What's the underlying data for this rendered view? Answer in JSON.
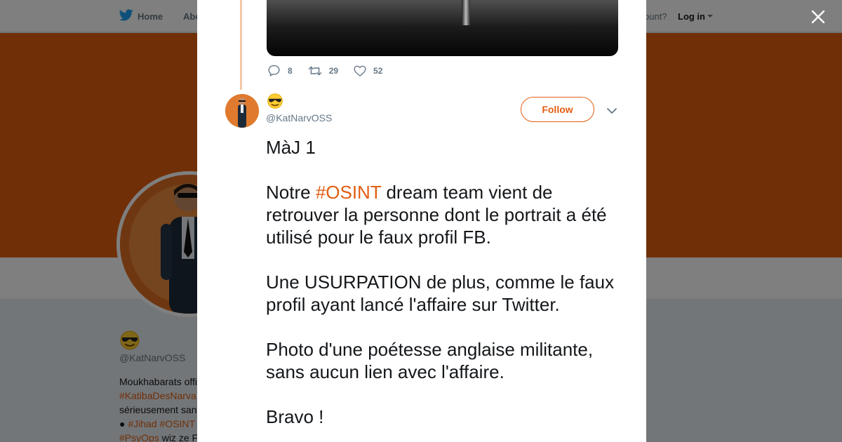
{
  "nav": {
    "home_label": "Home",
    "about_label": "Abo",
    "account_prompt": "ccount?",
    "login_label": "Log in"
  },
  "background_profile": {
    "emoji": "sunglasses-emoji",
    "handle": "@KatNarvOSS",
    "bio": [
      {
        "segments": [
          {
            "text": "Moukhabarats offi",
            "hashtag": false
          }
        ]
      },
      {
        "segments": [
          {
            "text": "#KatibaDesNarva",
            "hashtag": true
          }
        ]
      },
      {
        "segments": [
          {
            "text": "sérieusement san",
            "hashtag": false
          }
        ]
      },
      {
        "segments": [
          {
            "text": "● ",
            "hashtag": false
          },
          {
            "text": "#Jihad",
            "hashtag": true
          },
          {
            "text": " ",
            "hashtag": false
          },
          {
            "text": "#OSINT",
            "hashtag": true
          }
        ]
      },
      {
        "segments": [
          {
            "text": "#PsyOps",
            "hashtag": true
          },
          {
            "text": " wiz ze F",
            "hashtag": false
          }
        ]
      }
    ]
  },
  "previous_tweet": {
    "replies": "8",
    "retweets": "29",
    "likes": "52"
  },
  "tweet": {
    "name_emoji": "sunglasses-emoji",
    "handle": "@KatNarvOSS",
    "follow_label": "Follow",
    "paragraphs": [
      {
        "segments": [
          {
            "text": "MàJ 1",
            "hashtag": false
          }
        ]
      },
      {
        "segments": [
          {
            "text": "Notre ",
            "hashtag": false
          },
          {
            "text": "#OSINT",
            "hashtag": true
          },
          {
            "text": " dream team vient de retrouver la personne dont le portrait a été utilisé pour le faux profil FB.",
            "hashtag": false
          }
        ]
      },
      {
        "segments": [
          {
            "text": "Une USURPATION de plus, comme le faux profil ayant lancé l'affaire sur Twitter.",
            "hashtag": false
          }
        ]
      },
      {
        "segments": [
          {
            "text": "Photo d'une poétesse anglaise militante, sans aucun lien avec l'affaire.",
            "hashtag": false
          }
        ]
      },
      {
        "segments": [
          {
            "text": "Bravo !",
            "hashtag": false
          }
        ]
      }
    ]
  },
  "colors": {
    "accent": "#e25e11",
    "thread_line": "#f5c9a8"
  }
}
